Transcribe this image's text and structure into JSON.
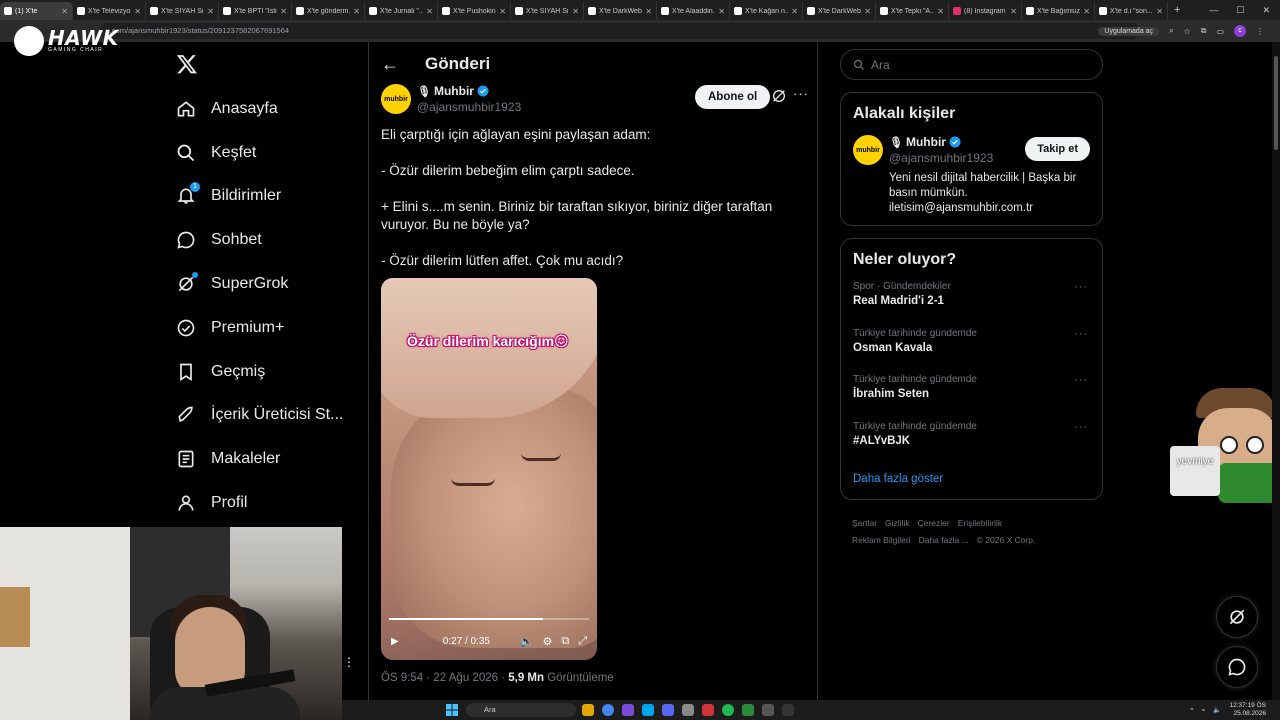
{
  "browser": {
    "tabs": [
      {
        "title": "(1) X'te",
        "active": true
      },
      {
        "title": "X'te Televizyon"
      },
      {
        "title": "X'te SİYAH Si..."
      },
      {
        "title": "X'te BPTİ \"İsti..."
      },
      {
        "title": "X'te gönderm..."
      },
      {
        "title": "X'te Jurnali \"..."
      },
      {
        "title": "X'te Pushokin..."
      },
      {
        "title": "X'te SİYAH Si..."
      },
      {
        "title": "X'te DarkWeb..."
      },
      {
        "title": "X'te Alaaddin..."
      },
      {
        "title": "X'te Kağan n..."
      },
      {
        "title": "X'te DarkWeb..."
      },
      {
        "title": "X'te Tepki \"A..."
      },
      {
        "title": "(8) Instagram"
      },
      {
        "title": "X'te Bağımsız..."
      },
      {
        "title": "X'te d.i \"son..."
      }
    ],
    "new_tab": "+",
    "url": "x.com/ajansmuhbir1923/status/2091237582067691564",
    "open_in_app": "Uygulamada aç",
    "profile_initial": "c"
  },
  "overlay": {
    "brand": "HAWK",
    "brand_sub": "GAMING CHAIR",
    "ellipsis": "⋮"
  },
  "nav": {
    "items": [
      {
        "label": "Anasayfa",
        "icon": "home-icon"
      },
      {
        "label": "Keşfet",
        "icon": "search-icon"
      },
      {
        "label": "Bildirimler",
        "icon": "bell-icon",
        "badge": "1"
      },
      {
        "label": "Sohbet",
        "icon": "chat-icon"
      },
      {
        "label": "SuperGrok",
        "icon": "grok-icon"
      },
      {
        "label": "Premium+",
        "icon": "premium-icon"
      },
      {
        "label": "Geçmiş",
        "icon": "bookmark-icon"
      },
      {
        "label": "İçerik Üreticisi St...",
        "icon": "rocket-icon"
      },
      {
        "label": "Makaleler",
        "icon": "article-icon"
      },
      {
        "label": "Profil",
        "icon": "person-icon"
      }
    ]
  },
  "post": {
    "header_title": "Gönderi",
    "author_name": "Muhbir",
    "author_handle": "@ajansmuhbir1923",
    "avatar_text": "muhbir",
    "subscribe_label": "Abone ol",
    "text": [
      "Eli çarptığı için ağlayan eşini paylaşan adam:",
      "- Özür dilerim bebeğim elim çarptı sadece.",
      "+ Elini s....m senin. Biriniz bir taraftan sıkıyor, biriniz diğer taraftan vuruyor. Bu ne böyle ya?",
      "- Özür dilerim lütfen affet. Çok mu acıdı?"
    ],
    "video": {
      "caption": "Özür dilerim karıcığım😖",
      "time": "0:27 / 0:35",
      "progress": 0.77
    },
    "time": "ÖS 9:54 · 22 Ağu 2026 · ",
    "views": "5,9 Mn",
    "views_label": " Görüntüleme"
  },
  "sidebar": {
    "search_placeholder": "Ara",
    "relevant_title": "Alakalı kişiler",
    "person": {
      "name": "Muhbir",
      "handle": "@ajansmuhbir1923",
      "follow_label": "Takip et",
      "bio": "Yeni nesil dijital habercilik | Başka bir basın mümkün. iletisim@ajansmuhbir.com.tr"
    },
    "trends_title": "Neler oluyor?",
    "trends": [
      {
        "context": "Spor · Gündemdekiler",
        "title": "Real Madrid'i 2-1"
      },
      {
        "context": "Türkiye tarihinde gündemde",
        "title": "Osman Kavala"
      },
      {
        "context": "Türkiye tarihinde gündemde",
        "title": "İbrahim Seten"
      },
      {
        "context": "Türkiye tarihinde gündemde",
        "title": "#ALYvBJK"
      }
    ],
    "show_more": "Daha fazla göster",
    "footer": [
      "Şartlar",
      "Gizlilik",
      "Çerezler",
      "Erişilebilirlik",
      "Reklam Bilgileri",
      "Daha fazla ...",
      "© 2026 X Corp."
    ]
  },
  "sticker": {
    "text": "yevmiye"
  },
  "taskbar": {
    "search": "Ara",
    "time": "12:37:19 ÖS",
    "date": "25.08.2026"
  },
  "colors": {
    "accent": "#1d9bf0",
    "background": "#000000",
    "border": "#2f3336",
    "muted": "#71767b",
    "avatar": "#ffd200"
  }
}
